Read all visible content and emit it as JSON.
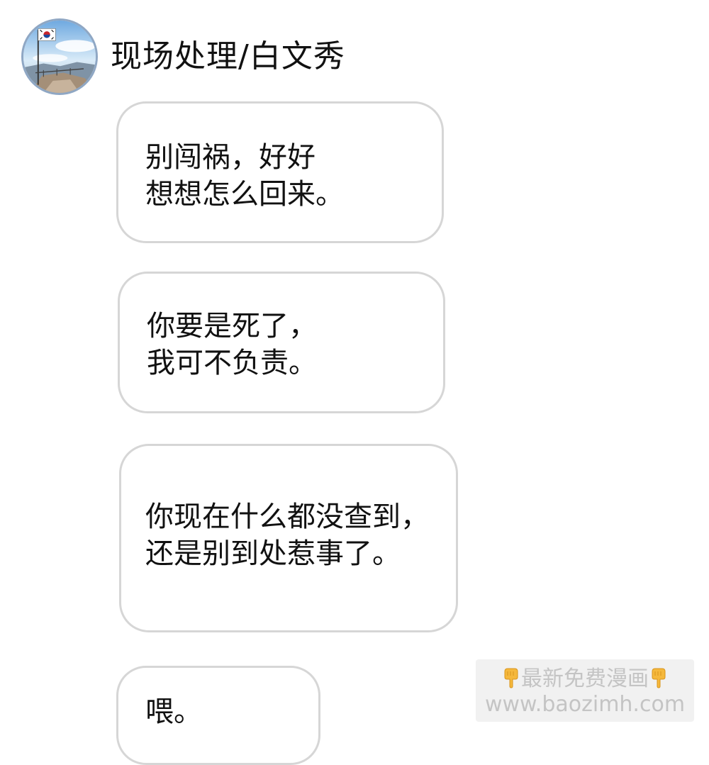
{
  "chat": {
    "sender_name": "现场处理/白文秀",
    "avatar_icon": "flag-mountain-avatar",
    "messages": [
      {
        "line1": "别闯祸，好好",
        "line2": "想想怎么回来。"
      },
      {
        "line1": "你要是死了，",
        "line2": "我可不负责。"
      },
      {
        "line1": "你现在什么都没查到，",
        "line2": "还是别到处惹事了。"
      },
      {
        "line1": "喂。"
      }
    ]
  },
  "watermark": {
    "line1": "最新免费漫画",
    "line2": "www.baozimh.com",
    "icon": "pointing-down-hand-icon"
  }
}
